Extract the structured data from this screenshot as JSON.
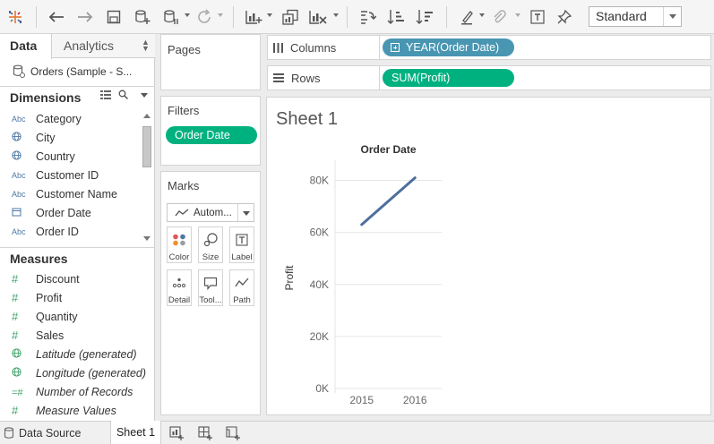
{
  "toolbar": {
    "mode_select": "Standard",
    "icons": [
      "tableau-logo-icon",
      "undo-icon",
      "redo-icon",
      "save-icon",
      "new-datasource-icon",
      "pause-updates-icon",
      "refresh-icon",
      "new-worksheet-icon",
      "duplicate-sheet-icon",
      "clear-sheet-icon",
      "swap-icon",
      "sort-ascending-icon",
      "sort-descending-icon",
      "highlight-icon",
      "attach-icon",
      "text-label-icon",
      "pin-icon"
    ]
  },
  "data_pane": {
    "tab_data": "Data",
    "tab_analytics": "Analytics",
    "datasource": "Orders (Sample - S...",
    "dimensions_title": "Dimensions",
    "measures_title": "Measures",
    "dimensions": [
      {
        "label": "Category",
        "icon": "Abc"
      },
      {
        "label": "City",
        "icon": "globe"
      },
      {
        "label": "Country",
        "icon": "globe"
      },
      {
        "label": "Customer ID",
        "icon": "Abc"
      },
      {
        "label": "Customer Name",
        "icon": "Abc"
      },
      {
        "label": "Order Date",
        "icon": "calendar"
      },
      {
        "label": "Order ID",
        "icon": "Abc"
      }
    ],
    "measures": [
      {
        "label": "Discount",
        "icon": "#"
      },
      {
        "label": "Profit",
        "icon": "#"
      },
      {
        "label": "Quantity",
        "icon": "#"
      },
      {
        "label": "Sales",
        "icon": "#"
      },
      {
        "label": "Latitude (generated)",
        "icon": "globe"
      },
      {
        "label": "Longitude (generated)",
        "icon": "globe"
      },
      {
        "label": "Number of Records",
        "icon": "=#"
      },
      {
        "label": "Measure Values",
        "icon": "#"
      }
    ]
  },
  "cards": {
    "pages": "Pages",
    "filters": "Filters",
    "filter_pill": "Order Date",
    "marks": "Marks",
    "mark_type": "Autom...",
    "mark_buttons": [
      {
        "label": "Color",
        "icon": "color-dots-icon"
      },
      {
        "label": "Size",
        "icon": "size-icon"
      },
      {
        "label": "Label",
        "icon": "label-icon"
      },
      {
        "label": "Detail",
        "icon": "detail-icon"
      },
      {
        "label": "Tool...",
        "icon": "tooltip-icon"
      },
      {
        "label": "Path",
        "icon": "path-icon"
      }
    ]
  },
  "shelves": {
    "columns_label": "Columns",
    "columns_pill": "YEAR(Order Date)",
    "rows_label": "Rows",
    "rows_pill": "SUM(Profit)"
  },
  "sheet_title": "Sheet 1",
  "bottom_tabs": {
    "datasource": "Data Source",
    "sheet": "Sheet 1"
  },
  "colors": {
    "accent_green": "#00b180",
    "accent_blue": "#4996b2",
    "line": "#4e6f9d"
  },
  "chart_data": {
    "type": "line",
    "title": "Order Date",
    "ylabel": "Profit",
    "categories": [
      "2015",
      "2016"
    ],
    "values": [
      63000,
      81000
    ],
    "ylim": [
      0,
      85000
    ],
    "yticks": [
      0,
      20000,
      40000,
      60000,
      80000
    ],
    "ytick_labels": [
      "0K",
      "20K",
      "40K",
      "60K",
      "80K"
    ],
    "grid": true
  }
}
